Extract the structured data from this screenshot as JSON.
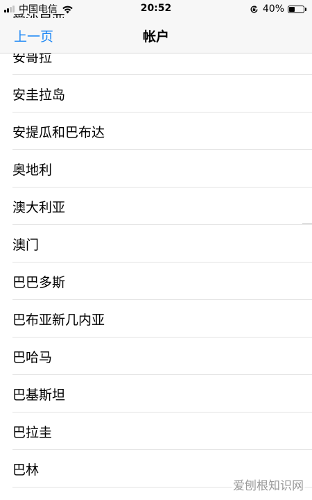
{
  "status_bar": {
    "carrier": "中国电信",
    "time": "20:52",
    "battery_percent": "40%",
    "battery_level": 0.4
  },
  "nav": {
    "back_label": "上一页",
    "title": "帐户"
  },
  "countries": [
    "爱沙尼亚",
    "安哥拉",
    "安圭拉岛",
    "安提瓜和巴布达",
    "奥地利",
    "澳大利亚",
    "澳门",
    "巴巴多斯",
    "巴布亚新几内亚",
    "巴哈马",
    "巴基斯坦",
    "巴拉圭",
    "巴林"
  ],
  "watermark": "爱刨根知识网",
  "colors": {
    "accent": "#1b86f5",
    "separator": "#e3e3e3",
    "bar_background": "#f7f7f7"
  }
}
